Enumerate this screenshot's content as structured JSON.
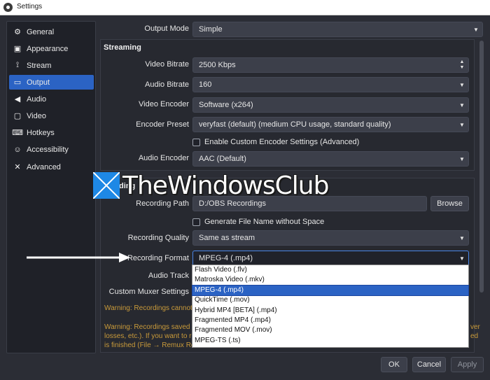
{
  "window": {
    "title": "Settings"
  },
  "sidebar": {
    "items": [
      {
        "label": "General",
        "icon": "gear-icon"
      },
      {
        "label": "Appearance",
        "icon": "appearance-icon"
      },
      {
        "label": "Stream",
        "icon": "broadcast-icon"
      },
      {
        "label": "Output",
        "icon": "output-icon",
        "active": true
      },
      {
        "label": "Audio",
        "icon": "speaker-icon"
      },
      {
        "label": "Video",
        "icon": "monitor-icon"
      },
      {
        "label": "Hotkeys",
        "icon": "keyboard-icon"
      },
      {
        "label": "Accessibility",
        "icon": "accessibility-icon"
      },
      {
        "label": "Advanced",
        "icon": "wrench-icon"
      }
    ]
  },
  "output_mode": {
    "label": "Output Mode",
    "value": "Simple"
  },
  "streaming": {
    "section_title": "Streaming",
    "video_bitrate": {
      "label": "Video Bitrate",
      "value": "2500 Kbps"
    },
    "audio_bitrate": {
      "label": "Audio Bitrate",
      "value": "160"
    },
    "video_encoder": {
      "label": "Video Encoder",
      "value": "Software (x264)"
    },
    "encoder_preset": {
      "label": "Encoder Preset",
      "value": "veryfast (default) (medium CPU usage, standard quality)"
    },
    "custom_encoder_checkbox": "Enable Custom Encoder Settings (Advanced)",
    "audio_encoder": {
      "label": "Audio Encoder",
      "value": "AAC (Default)"
    }
  },
  "recording": {
    "section_title_fragment": "ding",
    "recording_path": {
      "label": "Recording Path",
      "value": "D:/OBS Recordings",
      "browse_label": "Browse"
    },
    "filename_checkbox": "Generate File Name without Space",
    "recording_quality": {
      "label": "Recording Quality",
      "value": "Same as stream"
    },
    "recording_format": {
      "label": "Recording Format",
      "value": "MPEG-4 (.mp4)"
    },
    "audio_track_label": "Audio Track",
    "custom_muxer_label": "Custom Muxer Settings"
  },
  "format_options": [
    "Flash Video (.flv)",
    "Matroska Video (.mkv)",
    "MPEG-4 (.mp4)",
    "QuickTime (.mov)",
    "Hybrid MP4 [BETA] (.mp4)",
    "Fragmented MP4 (.mp4)",
    "Fragmented MOV (.mov)",
    "MPEG-TS (.ts)"
  ],
  "format_selected_index": 2,
  "warnings": {
    "line1": "Warning: Recordings cannot b",
    "line2a": "Warning: Recordings saved to",
    "line2a_right": "ver",
    "line2b": "losses, etc.). If you want to re",
    "line2b_right": "ed",
    "line2c": "is finished (File → Remux Recordi"
  },
  "footer": {
    "ok_label": "OK",
    "cancel_label": "Cancel",
    "apply_label": "Apply"
  },
  "watermark": {
    "text": "TheWindowsClub"
  },
  "colors": {
    "accent": "#2b63c4",
    "warning": "#c99a3a",
    "panel": "#272930",
    "background": "#2b2d35"
  }
}
